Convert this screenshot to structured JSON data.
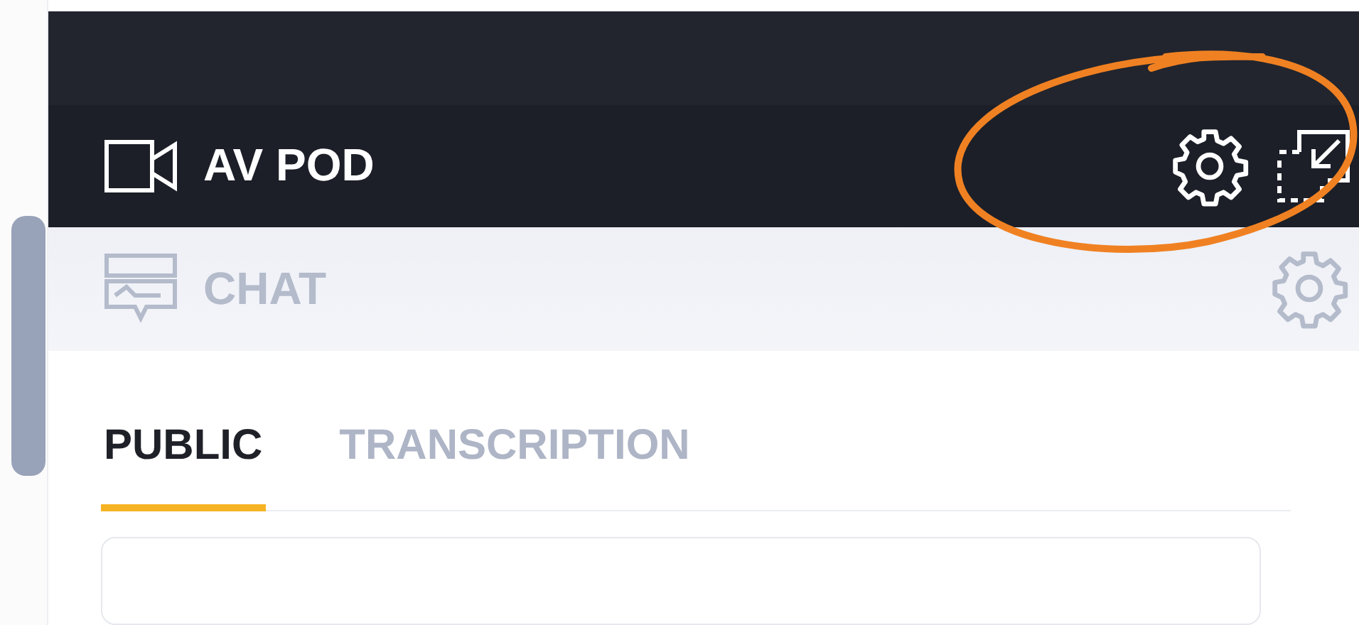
{
  "pods": [
    {
      "kind": "av",
      "title": "AV POD",
      "active": true
    },
    {
      "kind": "chat",
      "title": "CHAT",
      "active": false
    }
  ],
  "tabs": [
    {
      "label": "PUBLIC",
      "selected": true
    },
    {
      "label": "TRANSCRIPTION",
      "selected": false
    }
  ],
  "annotation": {
    "kind": "circle",
    "color": "#f08122"
  }
}
